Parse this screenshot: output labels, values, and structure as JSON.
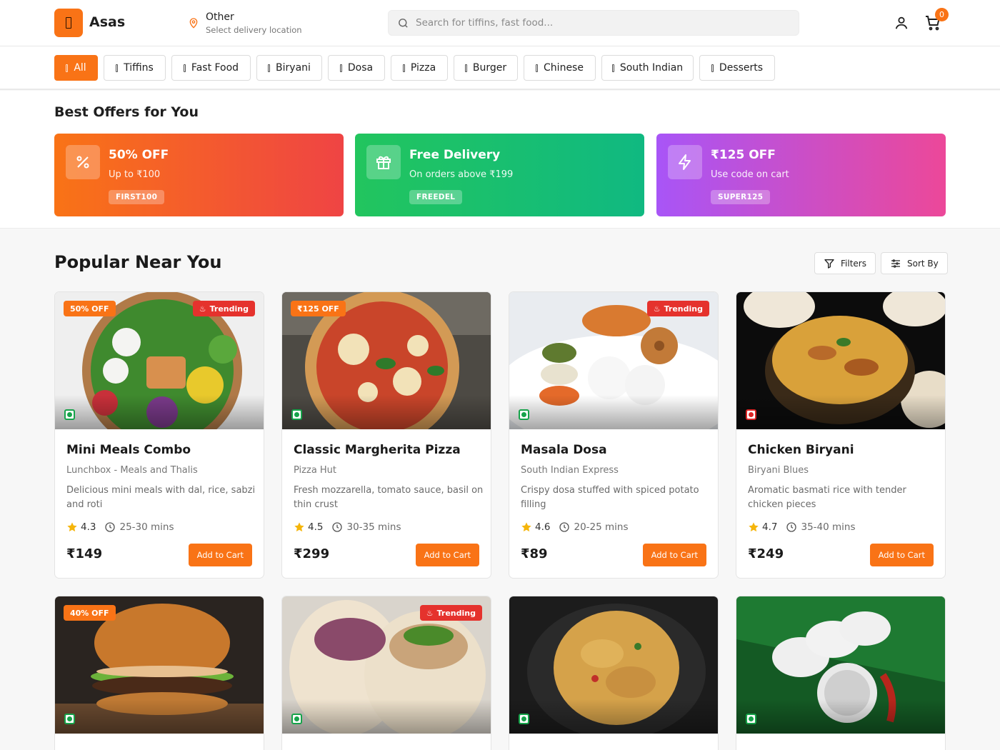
{
  "header": {
    "brand": "Asas",
    "location_title": "Other",
    "location_sub": "Select delivery location",
    "search_placeholder": "Search for tiffins, fast food...",
    "cart_count": "0"
  },
  "categories": [
    "All",
    "Tiffins",
    "Fast Food",
    "Biryani",
    "Dosa",
    "Pizza",
    "Burger",
    "Chinese",
    "South Indian",
    "Desserts"
  ],
  "offers": {
    "section_title": "Best Offers for You",
    "items": [
      {
        "title": "50% OFF",
        "sub": "Up to ₹100",
        "code": "FIRST100",
        "icon": "percent-icon"
      },
      {
        "title": "Free Delivery",
        "sub": "On orders above ₹199",
        "code": "FREEDEL",
        "icon": "gift-icon"
      },
      {
        "title": "₹125 OFF",
        "sub": "Use code on cart",
        "code": "SUPER125",
        "icon": "lightning-icon"
      }
    ]
  },
  "popular": {
    "title": "Popular Near You",
    "filters_label": "Filters",
    "sort_label": "Sort By",
    "add_label": "Add to Cart",
    "trending_label": "Trending",
    "items": [
      {
        "name": "Mini Meals Combo",
        "restaurant": "Lunchbox - Meals and Thalis",
        "desc": "Delicious mini meals with dal, rice, sabzi and roti",
        "rating": "4.3",
        "time": "25-30 mins",
        "price": "₹149",
        "badge": "50% OFF",
        "veg": true
      },
      {
        "name": "Classic Margherita Pizza",
        "restaurant": "Pizza Hut",
        "desc": "Fresh mozzarella, tomato sauce, basil on thin crust",
        "rating": "4.5",
        "time": "30-35 mins",
        "price": "₹299",
        "badge": "₹125 OFF",
        "veg": true
      },
      {
        "name": "Masala Dosa",
        "restaurant": "South Indian Express",
        "desc": "Crispy dosa stuffed with spiced potato filling",
        "rating": "4.6",
        "time": "20-25 mins",
        "price": "₹89",
        "badge": "",
        "veg": true
      },
      {
        "name": "Chicken Biryani",
        "restaurant": "Biryani Blues",
        "desc": "Aromatic basmati rice with tender chicken pieces",
        "rating": "4.7",
        "time": "35-40 mins",
        "price": "₹249",
        "badge": "",
        "veg": false
      },
      {
        "badge": "40% OFF",
        "veg": true
      },
      {
        "badge": "",
        "veg": true
      },
      {
        "badge": "",
        "veg": true
      },
      {
        "badge": "",
        "veg": true
      }
    ]
  },
  "colors": {
    "accent": "#f97316",
    "trending": "#e5322d",
    "veg": "#16a34a",
    "nonveg": "#dc2626"
  }
}
